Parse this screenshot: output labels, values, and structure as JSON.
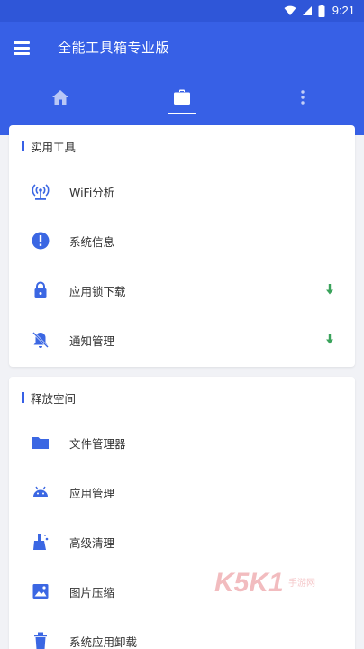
{
  "status_bar": {
    "time": "9:21",
    "icons": [
      "wifi-icon",
      "cell-signal-icon",
      "battery-icon"
    ]
  },
  "app_bar": {
    "title": "全能工具箱专业版",
    "menu_icon": "menu-icon",
    "tabs": [
      {
        "icon": "home-icon",
        "selected": false
      },
      {
        "icon": "briefcase-icon",
        "selected": true
      },
      {
        "icon": "more-vertical-icon",
        "selected": false
      }
    ]
  },
  "sections": [
    {
      "title": "实用工具",
      "items": [
        {
          "label": "WiFi分析",
          "icon": "wifi-tower-icon",
          "download": false
        },
        {
          "label": "系统信息",
          "icon": "info-icon",
          "download": false
        },
        {
          "label": "应用锁下载",
          "icon": "lock-icon",
          "download": true
        },
        {
          "label": "通知管理",
          "icon": "notifications-off-icon",
          "download": true
        }
      ]
    },
    {
      "title": "释放空间",
      "items": [
        {
          "label": "文件管理器",
          "icon": "folder-icon",
          "download": false
        },
        {
          "label": "应用管理",
          "icon": "android-icon",
          "download": false
        },
        {
          "label": "高级清理",
          "icon": "broom-icon",
          "download": false
        },
        {
          "label": "图片压缩",
          "icon": "image-icon",
          "download": false
        },
        {
          "label": "系统应用卸载",
          "icon": "trash-icon",
          "download": false
        }
      ]
    }
  ],
  "watermark": {
    "text": "K5K1",
    "subtext": "手游网"
  },
  "colors": {
    "primary": "#3760e6",
    "status_bar": "#2f56d8",
    "background": "#f1f2f6",
    "icon_blue": "#3b67e3",
    "download_green": "#3aa35b",
    "watermark_red": "#e8858a"
  }
}
